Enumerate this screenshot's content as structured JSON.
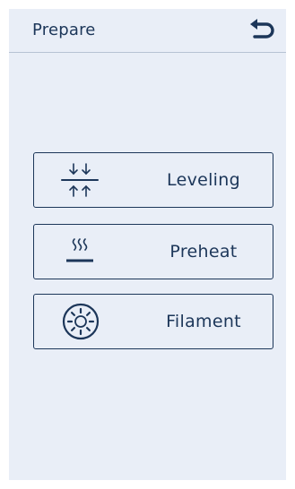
{
  "header": {
    "title": "Prepare",
    "back_icon": "back-arrow-icon"
  },
  "menu": [
    {
      "label": "Leveling",
      "icon": "leveling-icon"
    },
    {
      "label": "Preheat",
      "icon": "preheat-icon"
    },
    {
      "label": "Filament",
      "icon": "filament-icon"
    }
  ],
  "colors": {
    "background": "#e9eef7",
    "primary": "#1c3659",
    "divider": "#b7c3d3"
  }
}
